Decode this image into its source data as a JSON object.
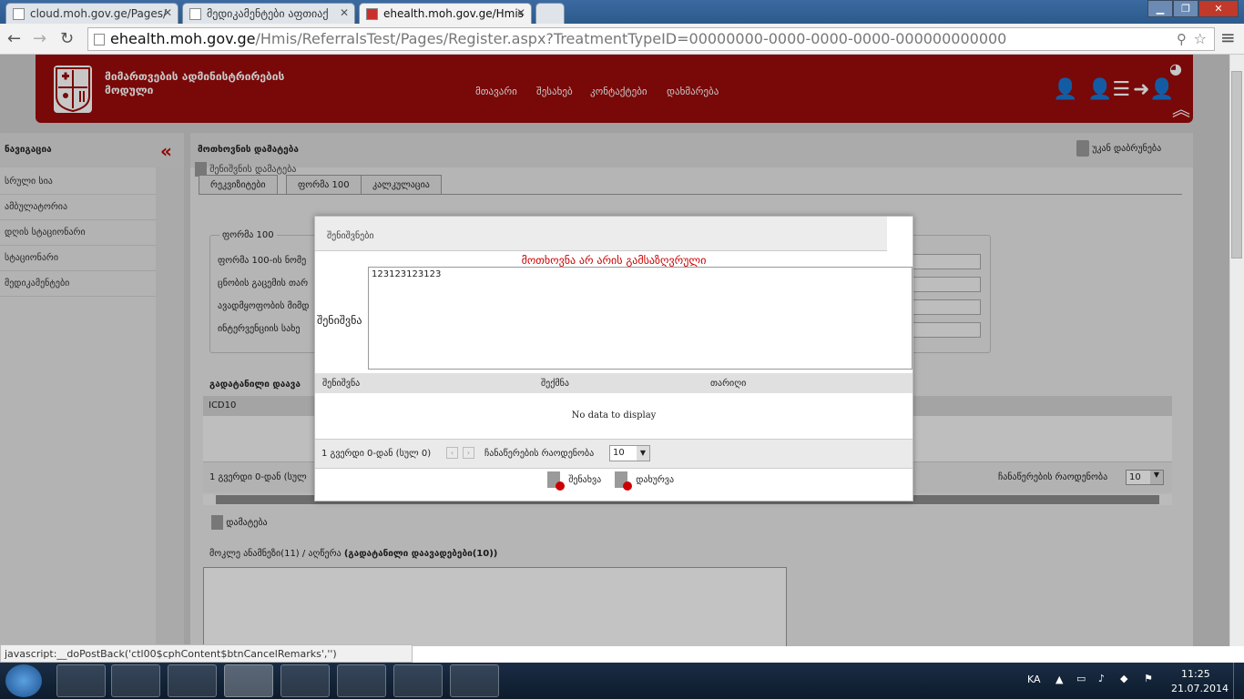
{
  "browser": {
    "tabs": [
      {
        "title": "cloud.moh.gov.ge/Pages/"
      },
      {
        "title": "მედიკამენტები აფთიაქ"
      },
      {
        "title": "ehealth.moh.gov.ge/Hmis"
      }
    ],
    "url_host": "ehealth.moh.gov.ge",
    "url_path": "/Hmis/ReferralsTest/Pages/Register.aspx?TreatmentTypeID=00000000-0000-0000-0000-000000000000",
    "status_text": "javascript:__doPostBack('ctl00$cphContent$btnCancelRemarks','')"
  },
  "header": {
    "module_title_line1": "მიმართვების ადმინისტრირების",
    "module_title_line2": "მოდული",
    "nav": [
      "მთავარი",
      "შესახებ",
      "კონტაქტები",
      "დახმარება"
    ]
  },
  "sidebar": {
    "title": "ნავიგაცია",
    "items": [
      "სრული სია",
      "ამბულატორია",
      "დღის სტაციონარი",
      "სტაციონარი",
      "მედიკამენტები"
    ]
  },
  "main": {
    "title": "მოთხოვნის დამატება",
    "back_label": "უკან დაბრუნება",
    "add_note_label": "შენიშვნის დამატება",
    "tabs": [
      "რეკვიზიტები",
      "ფორმა 100",
      "კალკულაცია"
    ],
    "form_legend": "ფორმა 100",
    "form_labels": [
      "ფორმა 100-ის ნომე",
      "ცნობის გაცემის თარ",
      "ავადმყოფობის მიმდ",
      "ინტერვენციის სახე"
    ],
    "grid_title": "გადატანილი დაავა",
    "grid_col": "ICD10",
    "pager_text": "1 გვერდი 0-დან (სულ",
    "rows_label": "ჩანაწერების რაოდენობა",
    "rows_value": "10",
    "add_label": "დამატება",
    "textarea_label_prefix": "მოკლე ანამნეზი(11) / აღწერა",
    "textarea_label_bold": "(გადატანილი დაავადებები(10))"
  },
  "modal": {
    "title": "შენიშვნები",
    "error": "მოთხოვნა არ არის გამსაზღვრული",
    "note_label": "შენიშვნა",
    "note_value": "123123123123",
    "columns": [
      "შენიშვნა",
      "შექმნა",
      "თარიღი"
    ],
    "empty_text": "No data to display",
    "pager_text": "1 გვერდი 0-დან (სულ 0)",
    "rows_label": "ჩანაწერების რაოდენობა",
    "rows_value": "10",
    "save_label": "შენახვა",
    "close_label": "დახურვა"
  },
  "taskbar": {
    "lang": "KA",
    "time": "11:25",
    "date": "21.07.2014"
  },
  "colors": {
    "brand_red": "#9b0b0b",
    "error_red": "#cc0000"
  },
  "icons": [
    "search-icon",
    "star-icon",
    "user-icon",
    "user-list-icon",
    "user-arrow-icon",
    "chevron-up-icon",
    "collapse-icon",
    "document-add-icon",
    "document-cancel-icon"
  ]
}
